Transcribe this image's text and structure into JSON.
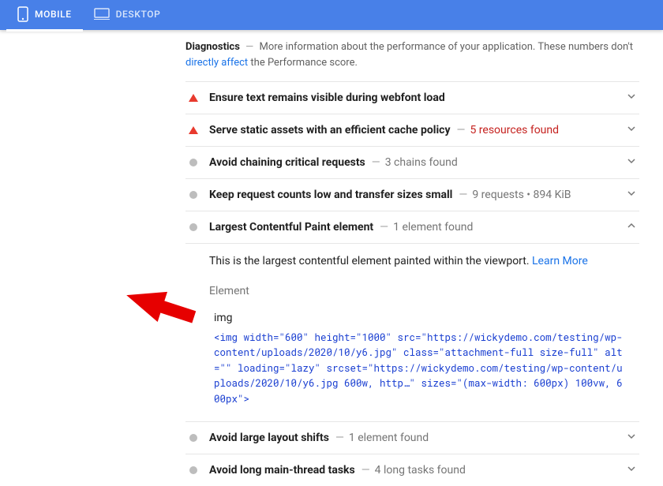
{
  "tabs": {
    "mobile": "MOBILE",
    "desktop": "DESKTOP"
  },
  "diagnostics": {
    "title": "Diagnostics",
    "subtitle_prefix": "More information about the performance of your application. These numbers don't ",
    "subtitle_link": "directly affect",
    "subtitle_suffix": " the Performance score."
  },
  "audits": [
    {
      "label": "Ensure text remains visible during webfont load",
      "hint": "",
      "warn": true,
      "expanded": false
    },
    {
      "label": "Serve static assets with an efficient cache policy",
      "hint": "5 resources found",
      "warn": true,
      "hint_red": true,
      "expanded": false
    },
    {
      "label": "Avoid chaining critical requests",
      "hint": "3 chains found",
      "warn": false,
      "expanded": false
    },
    {
      "label": "Keep request counts low and transfer sizes small",
      "hint": "9 requests • 894 KiB",
      "warn": false,
      "expanded": false
    },
    {
      "label": "Largest Contentful Paint element",
      "hint": "1 element found",
      "warn": false,
      "expanded": true
    },
    {
      "label": "Avoid large layout shifts",
      "hint": "1 element found",
      "warn": false,
      "expanded": false
    },
    {
      "label": "Avoid long main-thread tasks",
      "hint": "4 long tasks found",
      "warn": false,
      "expanded": false
    }
  ],
  "lcp_details": {
    "description_prefix": "This is the largest contentful element painted within the viewport. ",
    "learn_more": "Learn More",
    "element_section": "Element",
    "element_tag": "img",
    "element_code": "<img width=\"600\" height=\"1000\" src=\"https://wickydemo.com/testing/wp-content/uploads/2020/10/y6.jpg\" class=\"attachment-full size-full\" alt=\"\" loading=\"lazy\" srcset=\"https://wickydemo.com/testing/wp-content/uploads/2020/10/y6.jpg 600w, http…\" sizes=\"(max-width: 600px) 100vw, 600px\">"
  }
}
